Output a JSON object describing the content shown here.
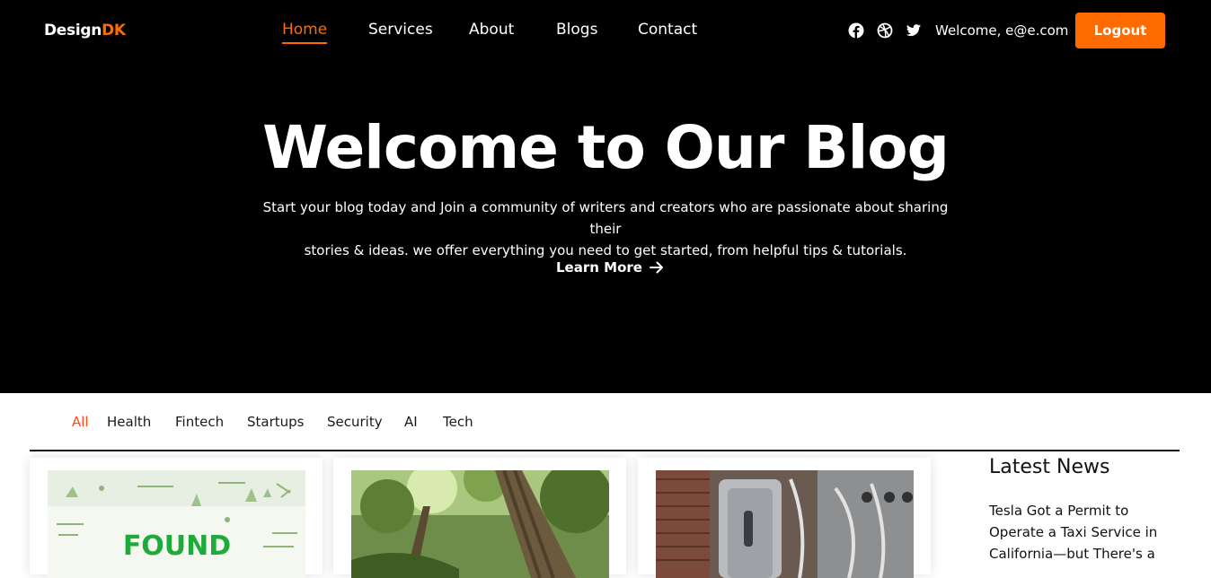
{
  "brand": {
    "name_main": "Design",
    "name_accent": "DK"
  },
  "nav": {
    "items": [
      {
        "label": "Home",
        "active": true
      },
      {
        "label": "Services",
        "active": false
      },
      {
        "label": "About",
        "active": false
      },
      {
        "label": "Blogs",
        "active": false
      },
      {
        "label": "Contact",
        "active": false
      }
    ]
  },
  "social_icons": [
    "facebook-icon",
    "dribbble-icon",
    "twitter-icon"
  ],
  "user": {
    "welcome_text": "Welcome, e@e.com",
    "logout_label": "Logout"
  },
  "hero": {
    "title": "Welcome to Our Blog",
    "subtitle_line1": "Start your blog today and Join a community of writers and creators who are passionate about sharing their",
    "subtitle_line2": "stories & ideas. we offer everything you need to get started, from helpful tips & tutorials.",
    "cta_label": "Learn More"
  },
  "categories": {
    "items": [
      {
        "label": "All",
        "active": true
      },
      {
        "label": "Health",
        "active": false
      },
      {
        "label": "Fintech",
        "active": false
      },
      {
        "label": "Startups",
        "active": false
      },
      {
        "label": "Security",
        "active": false
      },
      {
        "label": "AI",
        "active": false
      },
      {
        "label": "Tech",
        "active": false
      }
    ]
  },
  "cards": [
    {
      "image_caption": "FOUND"
    },
    {
      "image_caption": ""
    },
    {
      "image_caption": ""
    }
  ],
  "latest_news": {
    "title": "Latest News",
    "items": [
      {
        "headline_lines": [
          "Tesla Got a Permit to",
          "Operate a Taxi Service in",
          "California—but There's a"
        ]
      }
    ]
  },
  "colors": {
    "accent": "#ff6b00",
    "hero_bg": "#000000",
    "filter_active": "#ff4a1c"
  }
}
